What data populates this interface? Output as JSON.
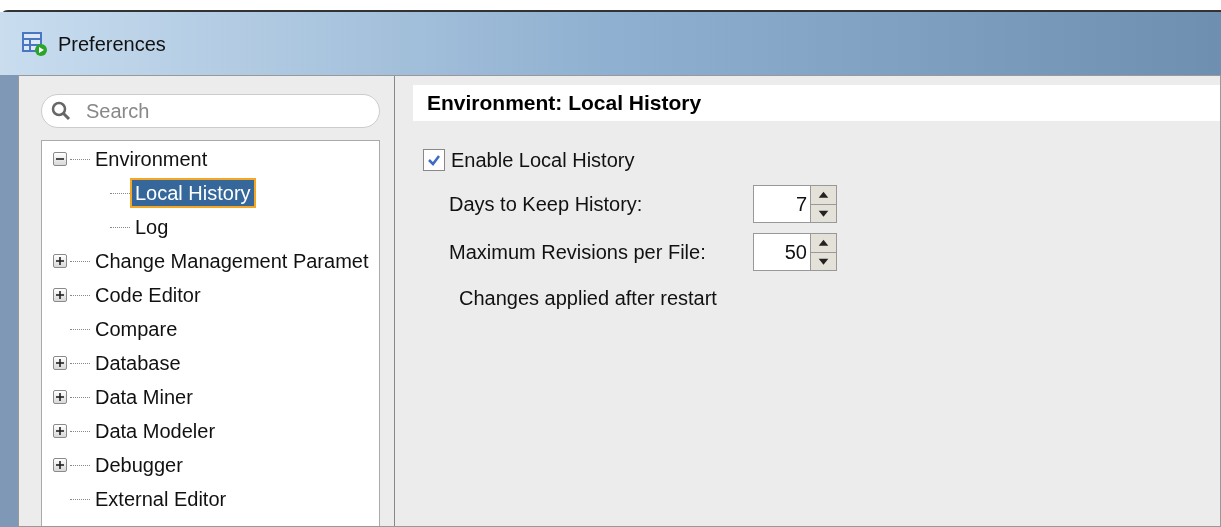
{
  "window": {
    "title": "Preferences"
  },
  "search": {
    "placeholder": "Search"
  },
  "tree": [
    {
      "label": "Environment",
      "expanded": true,
      "selected": false,
      "children": [
        {
          "label": "Local History",
          "selected": true
        },
        {
          "label": "Log",
          "selected": false
        }
      ]
    },
    {
      "label": "Change Management Paramet",
      "expanded": false,
      "selected": false
    },
    {
      "label": "Code Editor",
      "expanded": false,
      "selected": false
    },
    {
      "label": "Compare",
      "selected": false
    },
    {
      "label": "Database",
      "expanded": false,
      "selected": false
    },
    {
      "label": "Data Miner",
      "expanded": false,
      "selected": false
    },
    {
      "label": "Data Modeler",
      "expanded": false,
      "selected": false
    },
    {
      "label": "Debugger",
      "expanded": false,
      "selected": false
    },
    {
      "label": "External Editor",
      "selected": false
    }
  ],
  "panel": {
    "title": "Environment: Local History",
    "enable": {
      "label": "Enable Local History",
      "checked": true
    },
    "fields": [
      {
        "label": "Days to Keep History:",
        "value": "7"
      },
      {
        "label": "Maximum Revisions per File:",
        "value": "50"
      }
    ],
    "note": "Changes applied after restart"
  }
}
